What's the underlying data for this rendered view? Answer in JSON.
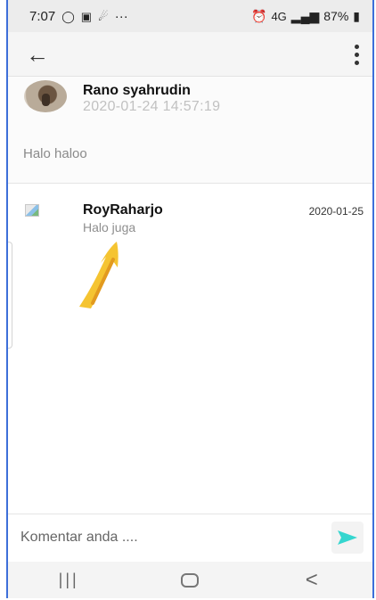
{
  "status_bar": {
    "time": "7:07",
    "left_icons": [
      "whatsapp-icon",
      "gallery-icon",
      "gesture-icon",
      "more-icon"
    ],
    "more": "···",
    "signal_label": "4G",
    "battery": "87%"
  },
  "header": {
    "back_icon": "arrow-left-icon",
    "menu_icon": "more-vert-icon"
  },
  "post": {
    "author": "Rano syahrudin",
    "timestamp": "2020-01-24 14:57:19",
    "content": "Halo haloo"
  },
  "comments": [
    {
      "author": "RoyRaharjo",
      "text": "Halo juga",
      "date": "2020-01-25"
    }
  ],
  "composer": {
    "placeholder": "Komentar anda ....",
    "send_icon": "send-icon"
  },
  "nav": {
    "recent": "|||",
    "home": "",
    "back": "<"
  }
}
